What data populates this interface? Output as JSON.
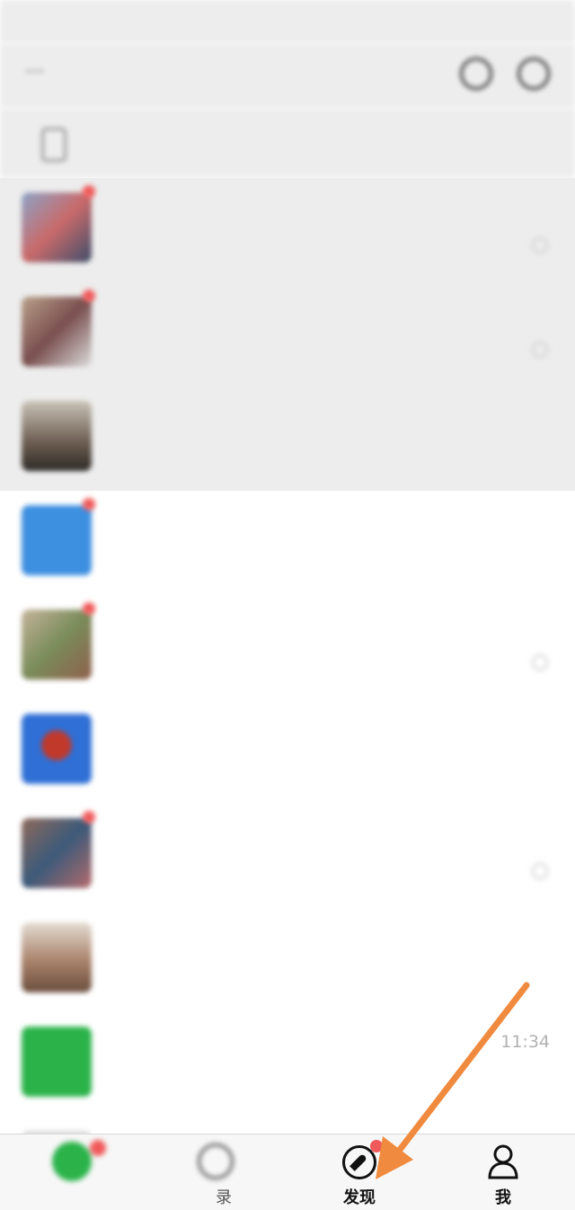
{
  "status_bar": {
    "left": "",
    "right": ""
  },
  "header": {
    "title": ""
  },
  "search": {
    "placeholder": ""
  },
  "chats": [
    {
      "name": "",
      "preview": "",
      "time": ""
    },
    {
      "name": "",
      "preview": "",
      "time": ""
    },
    {
      "name": "",
      "preview": "",
      "time": ""
    },
    {
      "name": "",
      "preview": "",
      "time": ""
    },
    {
      "name": "",
      "preview": "",
      "time": ""
    },
    {
      "name": "",
      "preview": "",
      "time": ""
    },
    {
      "name": "",
      "preview": "",
      "time": ""
    },
    {
      "name": "",
      "preview": "",
      "time": ""
    },
    {
      "name": "",
      "preview": "",
      "time": "11:34"
    }
  ],
  "tabs": [
    {
      "label": ""
    },
    {
      "label": "录"
    },
    {
      "label": "发现"
    },
    {
      "label": "我"
    }
  ],
  "colors": {
    "accent": "#f08a3e",
    "badge": "#f15a5a",
    "wechat_green": "#2bb34a"
  },
  "icons": [
    "compass-icon",
    "person-icon",
    "search-icon",
    "add-icon",
    "phone-icon"
  ]
}
